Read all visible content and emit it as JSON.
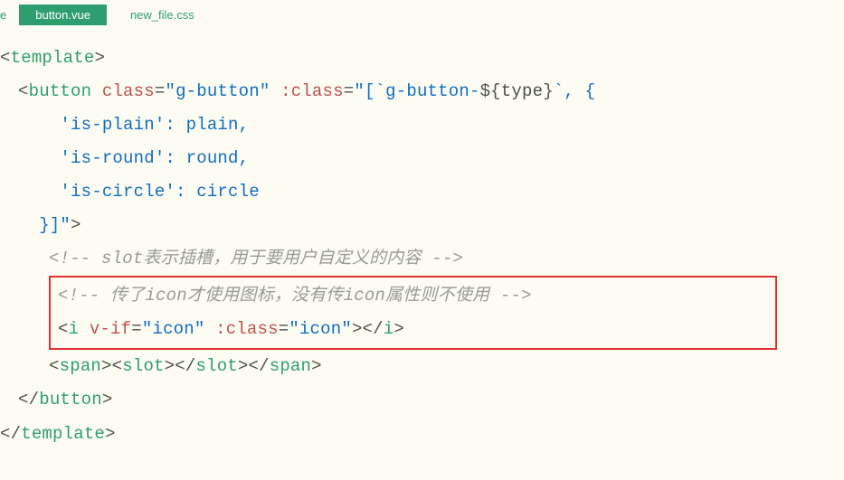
{
  "tabs": {
    "partial": "e",
    "active": "button.vue",
    "other": "new_file.css"
  },
  "code": {
    "l1_open": "<",
    "l1_tag": "template",
    "l1_close": ">",
    "l2_open": "<",
    "l2_tag": "button",
    "l2_sp": " ",
    "l2_attr1": "class",
    "l2_eq": "=",
    "l2_val1": "\"g-button\"",
    "l2_sp2": " ",
    "l2_attr2": ":class",
    "l2_eq2": "=",
    "l2_val2a": "\"[`g-button-",
    "l2_tpl": "${type}",
    "l2_val2b": "`, {",
    "l3": "    'is-plain': plain,",
    "l4": "    'is-round': round,",
    "l5": "    'is-circle': circle",
    "l6": "  }]\"",
    "l6b": ">",
    "l7": "<!-- slot表示插槽，用于要用户自定义的内容 -->",
    "l8": "<!-- 传了icon才使用图标，没有传icon属性则不使用 -->",
    "l9_open": "<",
    "l9_tag": "i",
    "l9_sp": " ",
    "l9_attr1": "v-if",
    "l9_eq": "=",
    "l9_val1": "\"icon\"",
    "l9_sp2": " ",
    "l9_attr2": ":class",
    "l9_eq2": "=",
    "l9_val2": "\"icon\"",
    "l9_close": "></",
    "l9_ctag": "i",
    "l9_end": ">",
    "l10_a": "<",
    "l10_span": "span",
    "l10_b": "><",
    "l10_slot": "slot",
    "l10_c": "></",
    "l10_slot2": "slot",
    "l10_d": "></",
    "l10_span2": "span",
    "l10_e": ">",
    "l11_a": "</",
    "l11_tag": "button",
    "l11_b": ">",
    "l12_a": "</",
    "l12_tag": "template",
    "l12_b": ">"
  }
}
